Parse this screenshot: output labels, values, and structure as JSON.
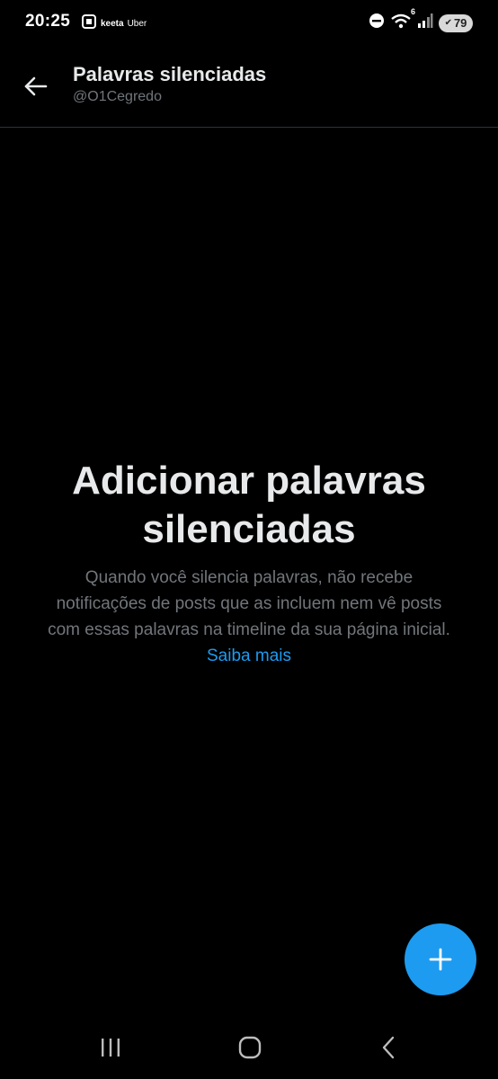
{
  "status_bar": {
    "time": "20:25",
    "app_labels": [
      "keeta",
      "Uber"
    ],
    "signal_badge": "6",
    "battery_level": "79"
  },
  "header": {
    "title": "Palavras silenciadas",
    "subtitle": "@O1Cegredo"
  },
  "empty_state": {
    "title": "Adicionar palavras silenciadas",
    "body": "Quando você silencia palavras, não recebe notificações de posts que as incluem nem vê posts com essas palavras na timeline da sua página inicial.",
    "link": "Saiba mais"
  },
  "colors": {
    "background": "#000000",
    "accent": "#1d9bf0",
    "primary_text": "#e7e9ea",
    "secondary_text": "#71767b"
  },
  "icons": {
    "back": "arrow-left-icon",
    "fab": "plus-icon",
    "nav_recents": "recents-icon",
    "nav_home": "home-icon",
    "nav_back": "back-icon"
  }
}
